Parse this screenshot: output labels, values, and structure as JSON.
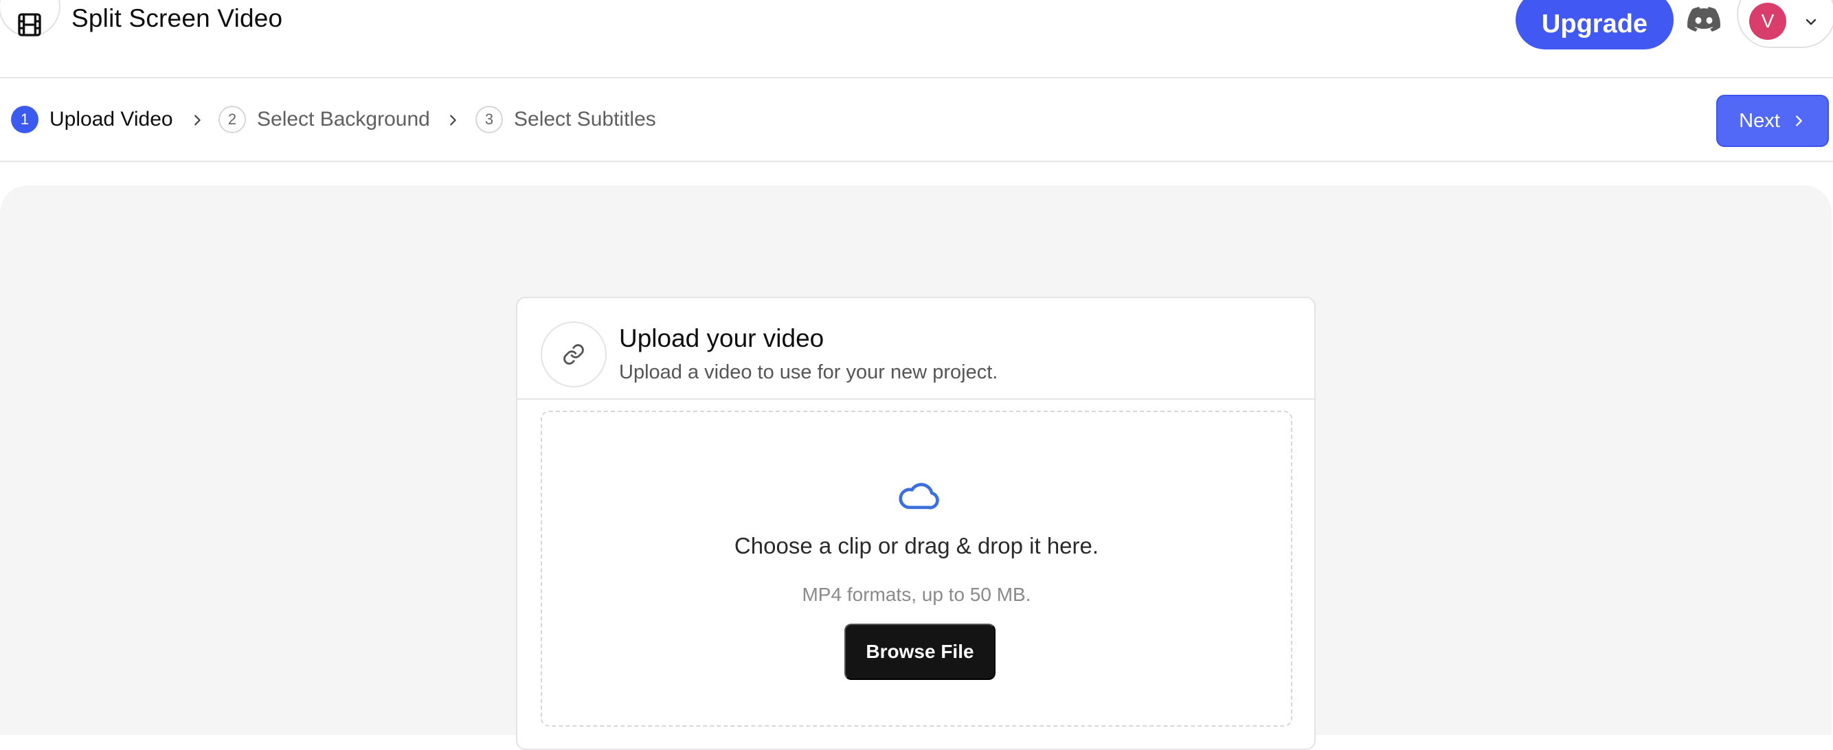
{
  "header": {
    "app_title": "Split Screen Video",
    "logo_icon": "film-icon",
    "upgrade_label": "Upgrade",
    "discord_icon": "discord-icon",
    "avatar_initial": "V",
    "colors": {
      "upgrade": "#4158f2",
      "avatar": "#d93d6b"
    }
  },
  "stepper": {
    "steps": [
      {
        "number": "1",
        "label": "Upload Video",
        "state": "active"
      },
      {
        "number": "2",
        "label": "Select Background",
        "state": "idle"
      },
      {
        "number": "3",
        "label": "Select Subtitles",
        "state": "idle"
      }
    ],
    "next_label": "Next",
    "colors": {
      "active": "#3b5bf0",
      "next": "#5268f6"
    }
  },
  "upload_card": {
    "icon": "link-icon",
    "title": "Upload your video",
    "subtitle": "Upload a video to use for your new project.",
    "dropzone": {
      "icon": "cloud-icon",
      "text": "Choose a clip or drag & drop it here.",
      "hint": "MP4 formats, up to 50 MB.",
      "button_label": "Browse File"
    }
  }
}
